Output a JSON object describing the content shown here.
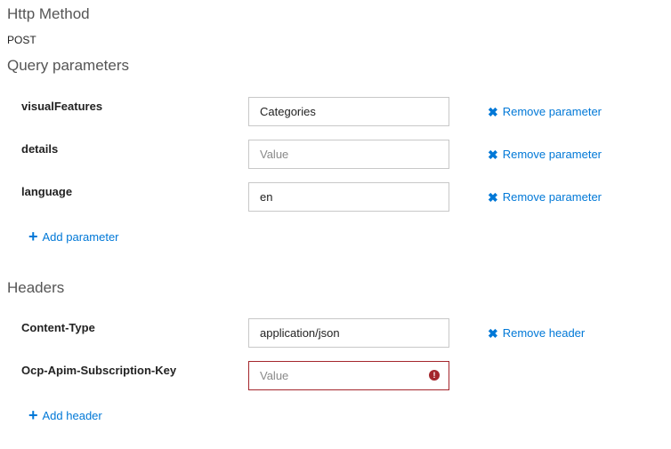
{
  "http_method": {
    "title": "Http Method",
    "value": "POST"
  },
  "query": {
    "title": "Query parameters",
    "params": [
      {
        "name": "visualFeatures",
        "value": "Categories",
        "placeholder": "Value",
        "remove_label": "Remove parameter"
      },
      {
        "name": "details",
        "value": "",
        "placeholder": "Value",
        "remove_label": "Remove parameter"
      },
      {
        "name": "language",
        "value": "en",
        "placeholder": "Value",
        "remove_label": "Remove parameter"
      }
    ],
    "add_label": "Add parameter"
  },
  "headers": {
    "title": "Headers",
    "items": [
      {
        "name": "Content-Type",
        "value": "application/json",
        "placeholder": "Value",
        "remove_label": "Remove header"
      },
      {
        "name": "Ocp-Apim-Subscription-Key",
        "value": "",
        "placeholder": "Value",
        "error_icon": "!"
      }
    ],
    "add_label": "Add header"
  },
  "icons": {
    "remove": "✖",
    "add": "+"
  },
  "colors": {
    "link": "#0078d7",
    "error": "#a4262c",
    "border": "#c8c8c8",
    "section_title": "#555555"
  }
}
